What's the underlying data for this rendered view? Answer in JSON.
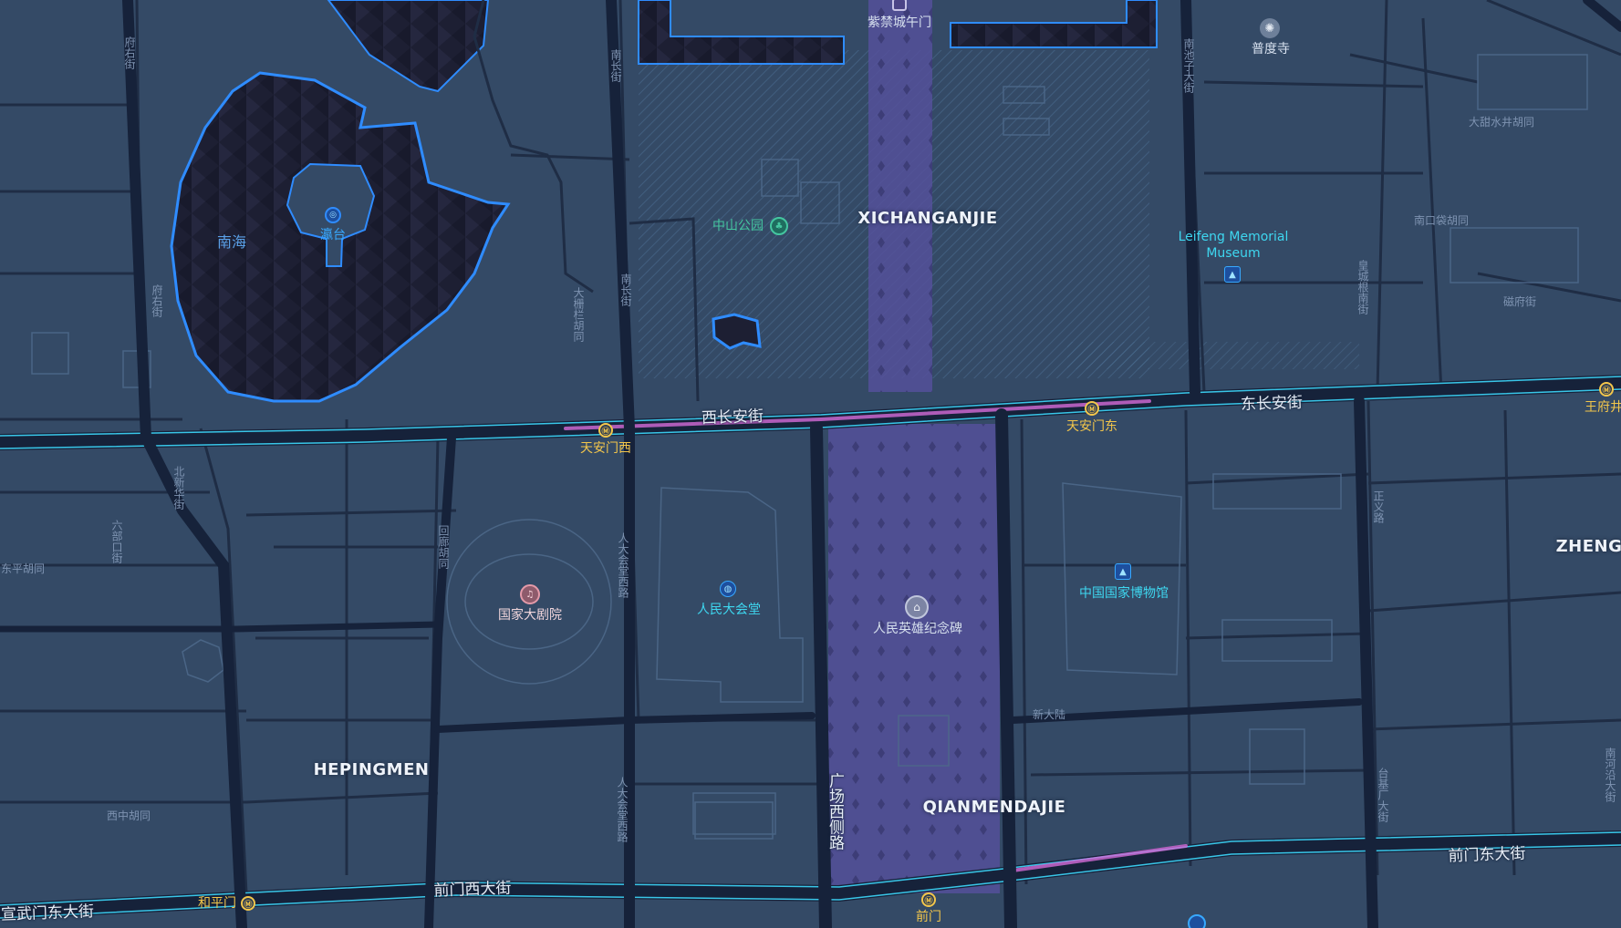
{
  "map": {
    "colors": {
      "background": "#344a66",
      "block_line": "#1f2d45",
      "major_road": "#16223a",
      "road_glow": "#39c6e8",
      "metro_line": "#d46bd8",
      "water": "#1d1f33",
      "water_outline": "#2f8cff",
      "plaza": "#5b4f9e",
      "park_hatch": "#4c6f93"
    },
    "districts": {
      "xichanganjie": "XICHANGANJIE",
      "qianmendajie": "QIANMENDAJIE",
      "hepingmen": "HEPINGMEN",
      "zheng": "ZHENG"
    },
    "streets": {
      "xichanganjie": "西长安街",
      "dongchanganjie": "东长安街",
      "qianmenxidajie": "前门西大街",
      "qianmendongdajie": "前门东大街",
      "xuanwumendongdajie": "宣武门东大街",
      "guangchangxiceluu": "广场西侧路",
      "nanchangjie_n": "南长街",
      "nanchangjie_s": "南长街",
      "nanchizi": "南池子大街",
      "fuyoujie": "府右街",
      "fuyoujie2": "府右街",
      "beixinhuajie": "北新华街",
      "renda_xi": "人大会堂西路",
      "renda_xi2": "人大会堂西路",
      "huilong": "回廊胡同",
      "dongjiaomin_w": "大栅栏胡同",
      "dongtianshui": "大甜水井胡同",
      "nankoudai": "南口袋胡同",
      "luanfu": "皇城根南街",
      "cifu": "磁府街",
      "zhengyi": "正义路",
      "taijichang": "台基厂大街",
      "xinsanlu": "新大陆",
      "xizhong": "西中胡同",
      "dongping": "东平胡同",
      "liufang": "六部口街",
      "nanheyan": "南河沿大街"
    },
    "pois": {
      "wumen": "紫禁城午门",
      "pudusi": "普度寺",
      "zhongshan_park": "中山公园",
      "nanhai": "南海",
      "yingtai": "瀛台",
      "leifeng_line1": "Leifeng Memorial",
      "leifeng_line2": "Museum",
      "grand_theatre": "国家大剧院",
      "great_hall": "人民大会堂",
      "monument": "人民英雄纪念碑",
      "national_museum": "中国国家博物馆"
    },
    "stations": {
      "tiananmen_west": "天安门西",
      "tiananmen_east": "天安门东",
      "hepingmen": "和平门",
      "qianmen": "前门",
      "wangfujing": "王府井"
    },
    "icons": {
      "metro": "metro-station-icon",
      "museum": "museum-icon",
      "park": "park-icon",
      "theatre": "theatre-icon",
      "landmark": "monument-icon",
      "temple": "temple-icon",
      "globe": "globe-icon",
      "yingtai": "scenic-spot-icon"
    }
  }
}
